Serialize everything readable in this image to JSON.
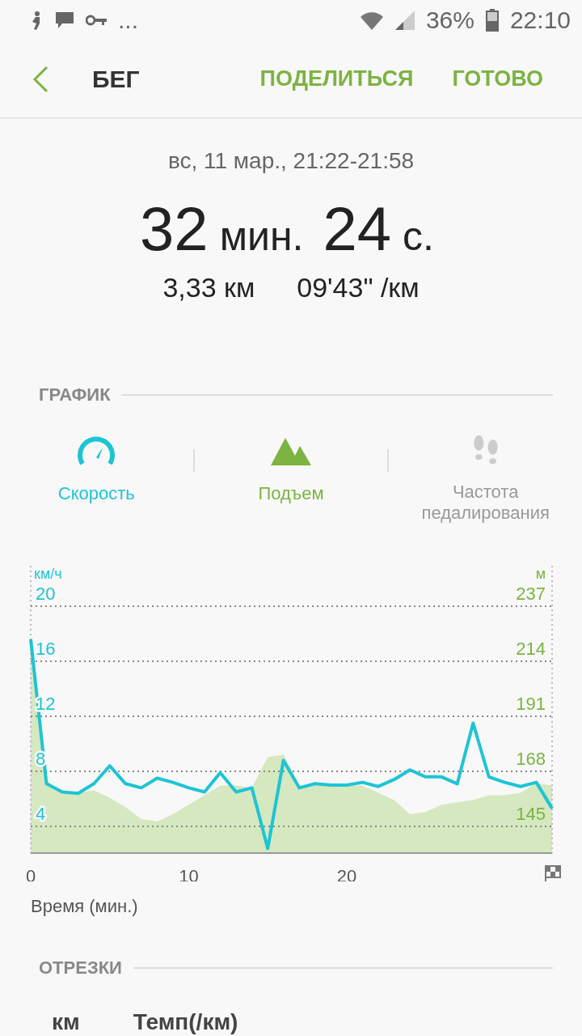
{
  "status_bar": {
    "more": "...",
    "battery": "36%",
    "time": "22:10"
  },
  "app_bar": {
    "title": "БЕГ",
    "actions": [
      "ПОДЕЛИТЬСЯ",
      "ГОТОВО"
    ]
  },
  "summary": {
    "date": "вс, 11 мар., 21:22-21:58",
    "duration": [
      {
        "value": "32",
        "unit": "мин."
      },
      {
        "value": "24",
        "unit": "с."
      }
    ],
    "distance": "3,33 км",
    "pace": "09'43\" /км"
  },
  "graph_section": {
    "title": "ГРАФИК"
  },
  "metric_tabs": [
    {
      "kind": "speed",
      "label": "Скорость",
      "active": true
    },
    {
      "kind": "elevation",
      "label": "Подъем",
      "active": true
    },
    {
      "kind": "cadence",
      "label": "Частота педалирования",
      "active": false
    }
  ],
  "chart": {
    "speed": {
      "chart_data": {
        "type": "line",
        "xlabel": "Время (мин.)",
        "ylabel": "км/ч",
        "xlim": [
          0,
          33
        ],
        "ylim": [
          2.06,
          22.94
        ],
        "xticks": [
          0,
          10,
          20
        ],
        "yticks": [
          20,
          16,
          12,
          8,
          4
        ],
        "grid": true,
        "x": [
          0,
          1,
          2,
          3,
          4,
          5,
          6,
          7,
          8,
          9,
          10,
          11,
          12,
          13,
          14,
          15,
          16,
          17,
          18,
          19,
          20,
          21,
          22,
          23,
          24,
          25,
          26,
          27,
          28,
          29,
          30,
          31,
          32,
          33
        ],
        "series": [
          {
            "color": "#1ec4d4",
            "values": [
              17.6,
              7.1,
              6.5,
              6.4,
              7.1,
              8.4,
              7.1,
              6.8,
              7.5,
              7.2,
              6.8,
              6.5,
              7.9,
              6.5,
              6.8,
              2.4,
              8.8,
              6.8,
              7.1,
              7.0,
              7.0,
              7.2,
              6.9,
              7.4,
              8.1,
              7.6,
              7.6,
              7.1,
              11.5,
              7.6,
              7.2,
              6.9,
              7.2,
              5.3
            ]
          }
        ]
      }
    },
    "elevation": {
      "chart_data": {
        "type": "area",
        "ylabel": "м",
        "xlim": [
          0,
          33
        ],
        "ylim": [
          133.8,
          253.9
        ],
        "yticks": [
          237,
          214,
          191,
          168,
          145
        ],
        "x": [
          0,
          1,
          2,
          3,
          4,
          5,
          6,
          7,
          8,
          9,
          10,
          11,
          12,
          13,
          14,
          15,
          16,
          17,
          18,
          19,
          20,
          21,
          22,
          23,
          24,
          25,
          26,
          27,
          28,
          29,
          30,
          31,
          32,
          33
        ],
        "series": [
          {
            "color": "#d5e8c0",
            "values": [
              220,
              164,
              159,
              159,
              160,
              157,
              153,
              148,
              147,
              150,
              154,
              158,
              162,
              162,
              161,
              174,
              175,
              162,
              162,
              162,
              162,
              162,
              159,
              156,
              150,
              151,
              154,
              155,
              156,
              158,
              158,
              159,
              163,
              162
            ]
          }
        ]
      }
    }
  },
  "segments_section": {
    "title": "ОТРЕЗКИ",
    "columns": [
      "км",
      "Темп(/км)"
    ]
  }
}
